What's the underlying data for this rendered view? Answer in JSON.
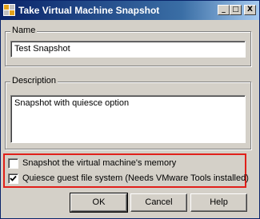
{
  "window": {
    "title": "Take Virtual Machine Snapshot",
    "controls": {
      "minimize": "_",
      "maximize": "□",
      "close": "X"
    }
  },
  "name_group": {
    "legend": "Name",
    "value": "Test Snapshot"
  },
  "description_group": {
    "legend": "Description",
    "value": "Snapshot with quiesce option"
  },
  "options": [
    {
      "label": "Snapshot the virtual machine's memory",
      "checked": false
    },
    {
      "label": "Quiesce guest file system (Needs VMware Tools installed)",
      "checked": true
    }
  ],
  "buttons": {
    "ok": "OK",
    "cancel": "Cancel",
    "help": "Help"
  },
  "colors": {
    "title_bar_start": "#0a246a",
    "title_bar_end": "#a6caf0",
    "highlight": "#e0201a",
    "dialog_background": "#d4d0c8"
  },
  "icons": {
    "app": "vmware-logo-icon",
    "check": "checkmark-icon"
  }
}
